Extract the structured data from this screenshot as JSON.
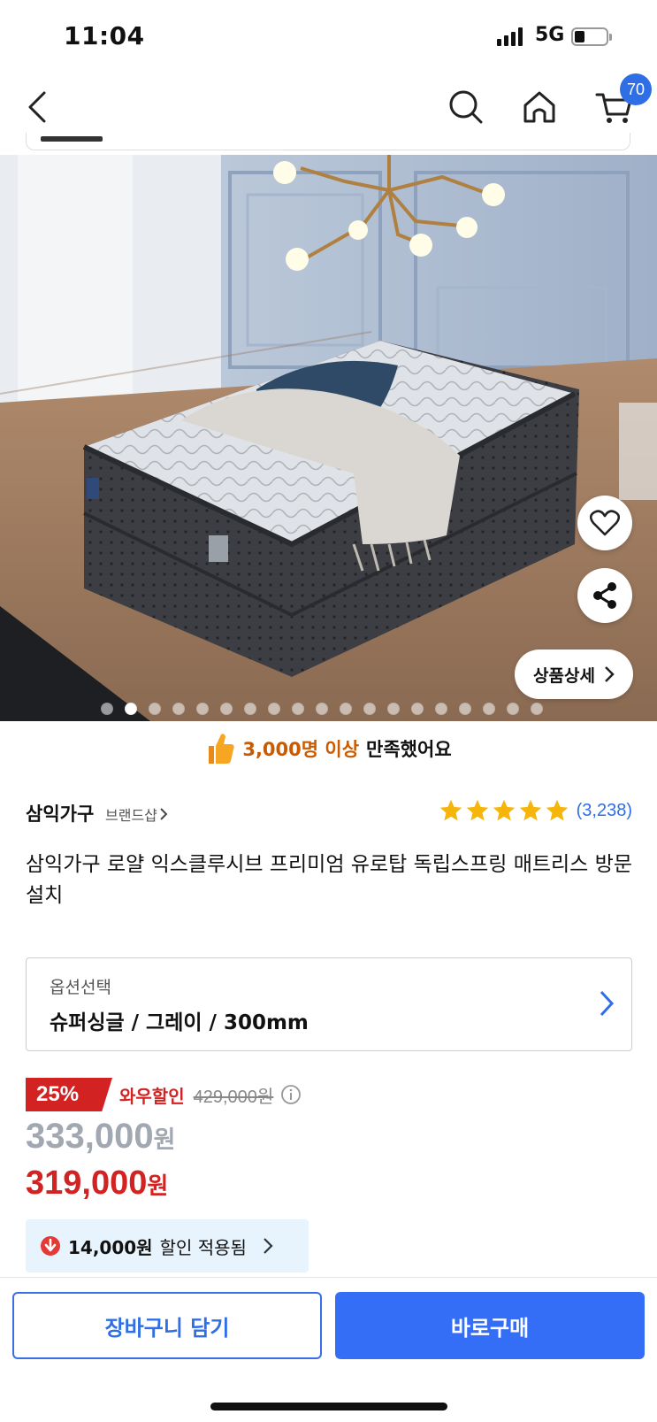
{
  "status": {
    "time": "11:04",
    "network": "5G"
  },
  "nav": {
    "cart_count": "70"
  },
  "hero": {
    "detail_label": "상품상세",
    "slide_count": 19,
    "active_slide": 2
  },
  "satisfaction": {
    "highlight": "3,000명 이상",
    "rest": "만족했어요"
  },
  "brand": {
    "name": "삼익가구",
    "shop_link": "브랜드샵",
    "rating_stars": 5,
    "review_count": "(3,238)"
  },
  "product": {
    "title": "삼익가구 로얄 익스클루시브 프리미엄 유로탑 독립스프링 매트리스 방문설치"
  },
  "option": {
    "label": "옵션선택",
    "value": "슈퍼싱글 / 그레이 / 300mm"
  },
  "price": {
    "discount_pct": "25%",
    "wow_label": "와우할인",
    "original": "429,000원",
    "sale_amount": "333,000",
    "final_amount": "319,000",
    "currency": "원"
  },
  "coupon": {
    "amount": "14,000원",
    "text": "할인 적용됨"
  },
  "actions": {
    "cart": "장바구니 담기",
    "buy": "바로구매"
  },
  "colors": {
    "accent": "#356ef6",
    "sale_red": "#d32222",
    "highlight_orange": "#c95a00"
  }
}
